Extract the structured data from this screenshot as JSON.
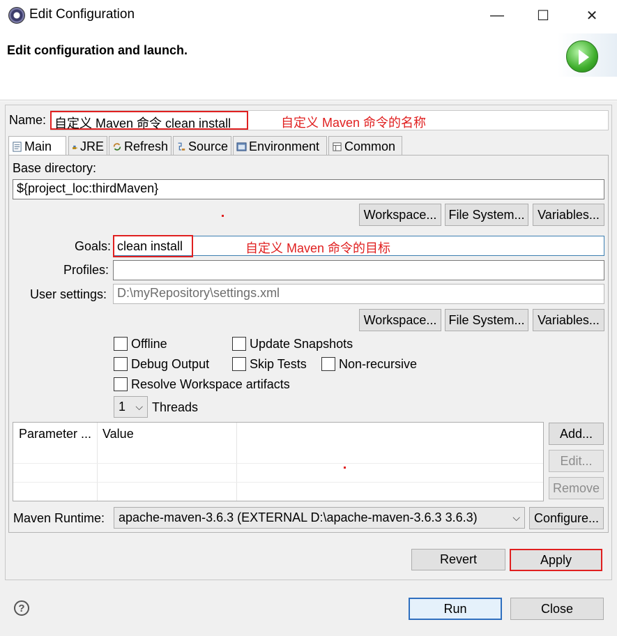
{
  "window": {
    "title": "Edit Configuration",
    "minimize_glyph": "—",
    "maximize_glyph": "☐",
    "close_glyph": "✕"
  },
  "header": {
    "title": "Edit configuration and launch."
  },
  "name_field": {
    "label": "Name:",
    "value": "自定义 Maven 命令 clean install",
    "annotation": "自定义 Maven 命令的名称"
  },
  "tabs": [
    {
      "label": "Main",
      "icon": "main-tab-icon"
    },
    {
      "label": "JRE",
      "icon": "jre-icon"
    },
    {
      "label": "Refresh",
      "icon": "refresh-icon"
    },
    {
      "label": "Source",
      "icon": "source-icon"
    },
    {
      "label": "Environment",
      "icon": "environment-icon"
    },
    {
      "label": "Common",
      "icon": "common-icon"
    }
  ],
  "main": {
    "base_directory_label": "Base directory:",
    "base_directory_value": "${project_loc:thirdMaven}",
    "workspace_button": "Workspace...",
    "file_system_button": "File System...",
    "variables_button": "Variables...",
    "goals_label": "Goals:",
    "goals_value": "clean install",
    "goals_annotation": "自定义 Maven 命令的目标",
    "profiles_label": "Profiles:",
    "profiles_value": "",
    "user_settings_label": "User settings:",
    "user_settings_value": "D:\\myRepository\\settings.xml",
    "checkboxes": {
      "offline": "Offline",
      "update_snapshots": "Update Snapshots",
      "debug_output": "Debug Output",
      "skip_tests": "Skip Tests",
      "non_recursive": "Non-recursive",
      "resolve_workspace": "Resolve Workspace artifacts"
    },
    "threads_value": "1",
    "threads_label": "Threads",
    "params_table": {
      "columns": [
        "Parameter ...",
        "Value"
      ]
    },
    "add_button": "Add...",
    "edit_button": "Edit...",
    "remove_button": "Remove",
    "maven_runtime_label": "Maven Runtime:",
    "maven_runtime_value": "apache-maven-3.6.3 (EXTERNAL D:\\apache-maven-3.6.3 3.6.3)",
    "configure_button": "Configure..."
  },
  "footer": {
    "revert_button": "Revert",
    "apply_button": "Apply",
    "run_button": "Run",
    "close_button": "Close",
    "help_glyph": "?"
  },
  "colors": {
    "annotation_red": "#e02020",
    "default_button_blue": "#2f6fbf",
    "dialog_bg": "#f0f0f0"
  }
}
